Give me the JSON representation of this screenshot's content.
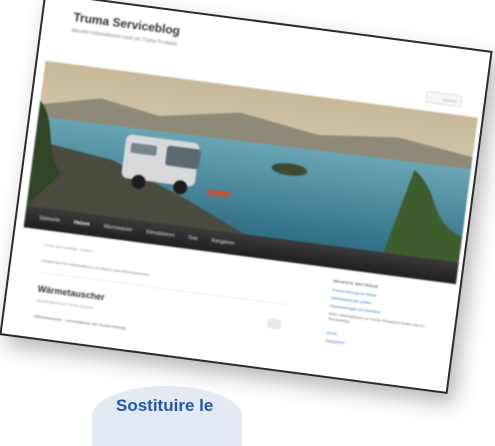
{
  "site": {
    "title": "Truma Serviceblog",
    "tagline": "Aktuelle Informationen rund um Truma Produkte"
  },
  "search": {
    "label": "Suchen"
  },
  "nav": {
    "items": [
      "Startseite",
      "Heizen",
      "Warmwasser",
      "Klimatisieren",
      "Gas",
      "Rangieren"
    ],
    "active_index": 1
  },
  "content": {
    "breadcrumb": "Truma Serviceblog › Heizen",
    "intro": "Finden Sie hier Informationen zu Heizen und Wärmetauscher.",
    "post_title": "Wärmetauscher",
    "post_meta": "Veröffentlicht von Truma Service",
    "post_excerpt": "Wärmetauscher – Informationen zur Truma Heizung"
  },
  "sidebar": {
    "heading": "NEUESTE BEITRÄGE",
    "links": [
      "Truma Heizung im Winter",
      "Wärmetauscher prüfen",
      "Gasdruckregler im Überblick"
    ],
    "text": "Mehr Informationen zu Truma Produkten finden Sie im Serviceblog.",
    "links2": [
      "Archiv",
      "Kategorien"
    ]
  },
  "badge": {
    "text": "Sostituire le"
  },
  "colors": {
    "nav_bg": "#2a2a2a",
    "link": "#2a6ebb",
    "badge_text": "#2455a3"
  }
}
